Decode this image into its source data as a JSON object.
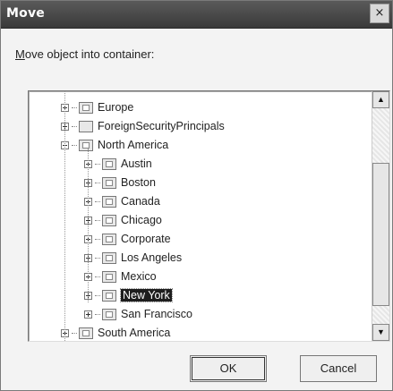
{
  "dialog": {
    "title": "Move",
    "close_glyph": "×",
    "instruction_prefix": "M",
    "instruction_rest": "ove object into container:"
  },
  "tree": {
    "items": [
      {
        "label": "Europe",
        "level": 1,
        "expander": "plus",
        "icon": "ou-folder-icon"
      },
      {
        "label": "ForeignSecurityPrincipals",
        "level": 1,
        "expander": "plus",
        "icon": "container-folder-icon"
      },
      {
        "label": "North America",
        "level": 1,
        "expander": "minus",
        "icon": "ou-folder-icon"
      },
      {
        "label": "Austin",
        "level": 2,
        "expander": "plus",
        "icon": "ou-folder-icon"
      },
      {
        "label": "Boston",
        "level": 2,
        "expander": "plus",
        "icon": "ou-folder-icon"
      },
      {
        "label": "Canada",
        "level": 2,
        "expander": "plus",
        "icon": "ou-folder-icon"
      },
      {
        "label": "Chicago",
        "level": 2,
        "expander": "plus",
        "icon": "ou-folder-icon"
      },
      {
        "label": "Corporate",
        "level": 2,
        "expander": "plus",
        "icon": "ou-folder-icon"
      },
      {
        "label": "Los Angeles",
        "level": 2,
        "expander": "plus",
        "icon": "ou-folder-icon"
      },
      {
        "label": "Mexico",
        "level": 2,
        "expander": "plus",
        "icon": "ou-folder-icon"
      },
      {
        "label": "New York",
        "level": 2,
        "expander": "plus",
        "icon": "ou-folder-icon",
        "selected": true
      },
      {
        "label": "San Francisco",
        "level": 2,
        "expander": "plus",
        "icon": "ou-folder-icon"
      },
      {
        "label": "South America",
        "level": 1,
        "expander": "plus",
        "icon": "ou-folder-icon"
      }
    ]
  },
  "scrollbar": {
    "up_glyph": "▲",
    "down_glyph": "▼"
  },
  "buttons": {
    "ok_label": "OK",
    "cancel_label": "Cancel"
  },
  "colors": {
    "titlebar": "#3a3a3a",
    "selection": "#1e1e1e"
  }
}
